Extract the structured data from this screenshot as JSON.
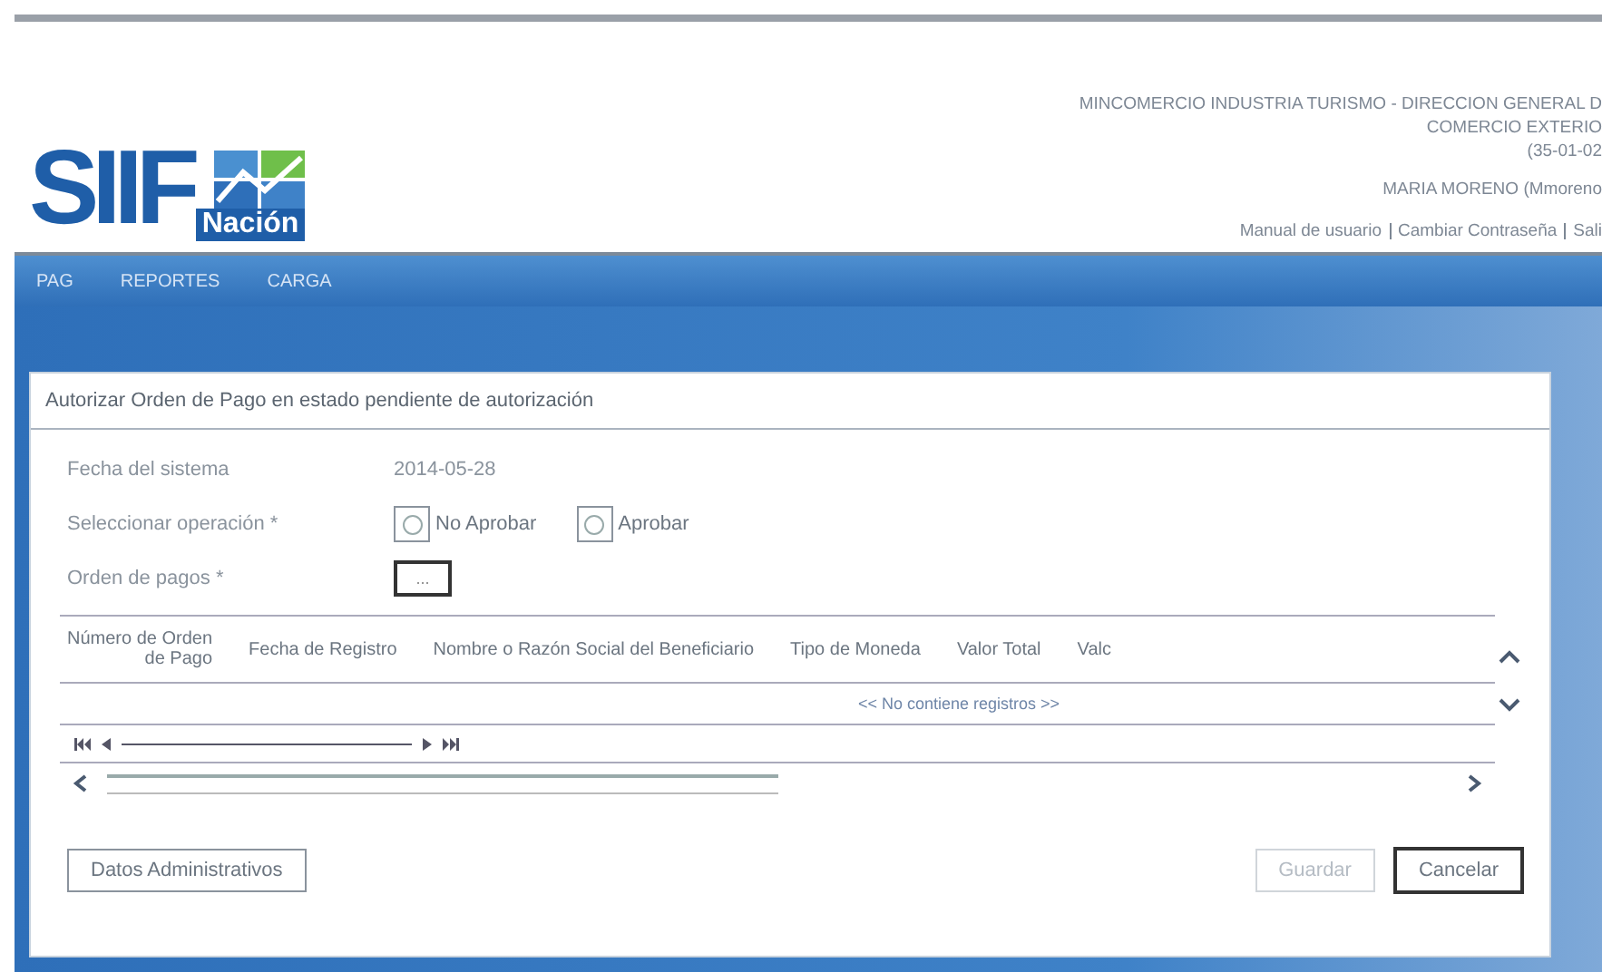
{
  "header": {
    "logo_text": "SIIF",
    "logo_subtext": "Nación",
    "org_lines": [
      "MINCOMERCIO INDUSTRIA TURISMO - DIRECCION GENERAL D",
      "COMERCIO EXTERIO",
      "(35-01-02"
    ],
    "user": "MARIA MORENO (Mmoreno",
    "links": [
      {
        "label": "Manual de usuario"
      },
      {
        "label": "Cambiar Contraseña"
      },
      {
        "label": "Sali"
      }
    ]
  },
  "menu": [
    {
      "label": "PAG"
    },
    {
      "label": "REPORTES"
    },
    {
      "label": "CARGA"
    }
  ],
  "panel": {
    "title": "Autorizar Orden de Pago en estado pendiente de autorización",
    "fields": [
      {
        "kind": "text",
        "label": "Fecha del sistema",
        "value": "2014-05-28"
      },
      {
        "kind": "radio",
        "label": "Seleccionar operación *",
        "options": [
          {
            "label": "No Aprobar",
            "selected": false
          },
          {
            "label": "Aprobar",
            "selected": false
          }
        ]
      },
      {
        "kind": "picker",
        "label": "Orden de pagos *",
        "value": "..."
      }
    ],
    "table": {
      "columns": [
        [
          "Número de Orden",
          "de Pago"
        ],
        [
          "Fecha de Registro"
        ],
        [
          "Nombre o Razón Social del Beneficiario"
        ],
        [
          "Tipo de Moneda"
        ],
        [
          "Valor Total"
        ],
        [
          "Valc"
        ]
      ],
      "empty": "<< No contiene registros >>"
    },
    "buttons": [
      {
        "label": "Datos Administrativos",
        "disabled": false,
        "kind": "left"
      },
      {
        "label": "Guardar",
        "disabled": true,
        "kind": "right"
      },
      {
        "label": "Cancelar",
        "disabled": false,
        "kind": "right"
      }
    ]
  }
}
